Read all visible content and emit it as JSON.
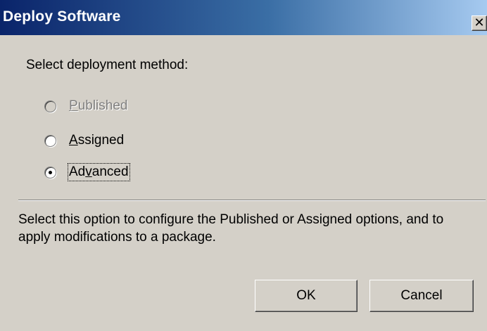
{
  "window": {
    "title": "Deploy Software",
    "close_glyph": "✕"
  },
  "dialog": {
    "prompt": "Select deployment method:",
    "options": [
      {
        "label": "Published",
        "accelerator_index": 0,
        "state": "disabled",
        "selected": false
      },
      {
        "label": "Assigned",
        "accelerator_index": 0,
        "state": "enabled",
        "selected": false
      },
      {
        "label": "Advanced",
        "accelerator_index": 2,
        "state": "enabled",
        "selected": true,
        "focused": true
      }
    ],
    "description": "Select this option to configure the Published or Assigned options, and to apply modifications to a package."
  },
  "buttons": {
    "ok_label": "OK",
    "cancel_label": "Cancel"
  },
  "colors": {
    "face": "#d4d0c8",
    "title_gradient_start": "#0a246a",
    "title_gradient_end": "#a6caf0",
    "disabled_text": "#808080"
  }
}
